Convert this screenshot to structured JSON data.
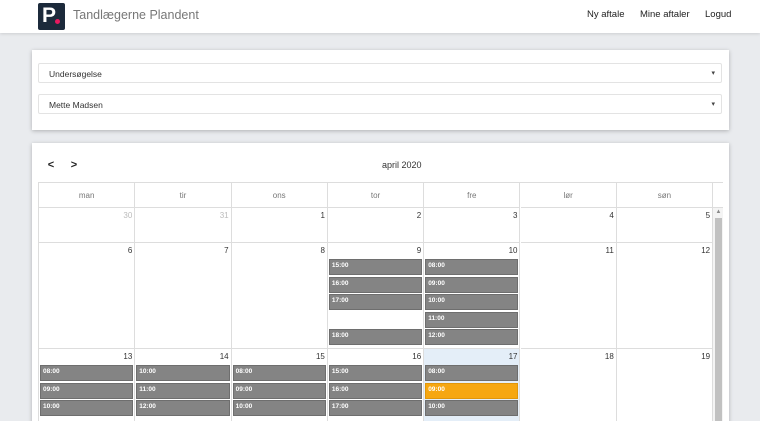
{
  "navbar": {
    "brand": "Tandlægerne Plandent",
    "links": [
      "Ny aftale",
      "Mine aftaler",
      "Logud"
    ]
  },
  "filters": {
    "service": "Undersøgelse",
    "dentist": "Mette Madsen"
  },
  "calendar": {
    "title": "april 2020",
    "prev": "<",
    "next": ">",
    "weekdays": [
      "man",
      "tir",
      "ons",
      "tor",
      "fre",
      "lør",
      "søn"
    ],
    "weeks": [
      {
        "days": [
          {
            "num": "30",
            "other": true,
            "events": []
          },
          {
            "num": "31",
            "other": true,
            "events": []
          },
          {
            "num": "1",
            "events": []
          },
          {
            "num": "2",
            "events": []
          },
          {
            "num": "3",
            "events": []
          },
          {
            "num": "4",
            "events": []
          },
          {
            "num": "5",
            "events": []
          }
        ]
      },
      {
        "days": [
          {
            "num": "6",
            "events": []
          },
          {
            "num": "7",
            "events": []
          },
          {
            "num": "8",
            "events": []
          },
          {
            "num": "9",
            "events": [
              "15:00",
              "16:00",
              "17:00",
              "",
              "18:00"
            ]
          },
          {
            "num": "10",
            "events": [
              "08:00",
              "09:00",
              "10:00",
              "11:00",
              "12:00"
            ]
          },
          {
            "num": "11",
            "events": []
          },
          {
            "num": "12",
            "events": []
          }
        ]
      },
      {
        "days": [
          {
            "num": "13",
            "events": [
              "08:00",
              "09:00",
              "10:00"
            ]
          },
          {
            "num": "14",
            "events": [
              "10:00",
              "11:00",
              "12:00"
            ]
          },
          {
            "num": "15",
            "events": [
              "08:00",
              "09:00",
              "10:00"
            ]
          },
          {
            "num": "16",
            "events": [
              "15:00",
              "16:00",
              "17:00"
            ]
          },
          {
            "num": "17",
            "today": true,
            "events": [
              "08:00",
              "09:00",
              "10:00"
            ],
            "selected_event": "09:00"
          },
          {
            "num": "18",
            "events": []
          },
          {
            "num": "19",
            "events": []
          }
        ]
      }
    ]
  },
  "colors": {
    "event": "#848484",
    "selected_event": "#f6a711",
    "today": "#e4eef8",
    "logo": "#1c2a3b",
    "logo_dot": "#e7195f"
  },
  "icons": {
    "dropdown": "▾",
    "scroll_up": "▲"
  }
}
